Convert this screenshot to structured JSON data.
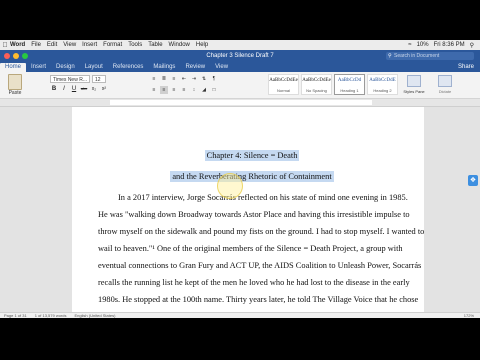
{
  "menubar": {
    "app": "Word",
    "items": [
      "File",
      "Edit",
      "View",
      "Insert",
      "Format",
      "Tools",
      "Table",
      "Window",
      "Help"
    ],
    "battery": "10%",
    "time": "Fri 8:36 PM"
  },
  "window": {
    "title": "Chapter 3 Silence Draft 7",
    "search_placeholder": "Search in Document"
  },
  "tabs": [
    "Home",
    "Insert",
    "Design",
    "Layout",
    "References",
    "Mailings",
    "Review",
    "View"
  ],
  "active_tab": "Home",
  "share_label": "Share",
  "ribbon": {
    "paste_label": "Paste",
    "font_name": "Times New R...",
    "font_size": "12",
    "format_buttons": [
      "B",
      "I",
      "U",
      "abc",
      "x₂",
      "x²"
    ],
    "styles": [
      {
        "sample": "AaBbCcDdEe",
        "name": "Normal"
      },
      {
        "sample": "AaBbCcDdEe",
        "name": "No Spacing"
      },
      {
        "sample": "AaBbCcDd",
        "name": "Heading 1"
      },
      {
        "sample": "AaBbCcDdE",
        "name": "Heading 2"
      }
    ],
    "styles_pane_label": "Styles Pane",
    "dictate_label": "Dictate"
  },
  "document": {
    "heading1": "Chapter 4: Silence = Death",
    "heading2": "and the Reverberating Rhetoric of Containment",
    "p1": "In a 2017 interview, Jorge Socarrás reflected on his state of mind one evening in 1985.",
    "p2": "He was \"walking down Broadway towards Astor Place and having this irresistible impulse to",
    "p3": "throw myself on the sidewalk and pound my fists on the ground. I had to stop myself. I wanted to",
    "p4": "wail to heaven.\"¹ One of the original members of the Silence = Death Project, a group with",
    "p5": "eventual connections to Gran Fury and ACT UP, the AIDS Coalition to Unleash Power, Socarrás",
    "p6": "recalls the running list he kept of the men he loved who he had lost to the disease in the early",
    "p7": "1980s. He stopped at the 100th name. Thirty years later, he told The Village Voice that he chose"
  },
  "statusbar": {
    "page": "Page 1 of 31",
    "words": "1 of 13,579 words",
    "language": "English (United States)",
    "zoom": "172%"
  }
}
